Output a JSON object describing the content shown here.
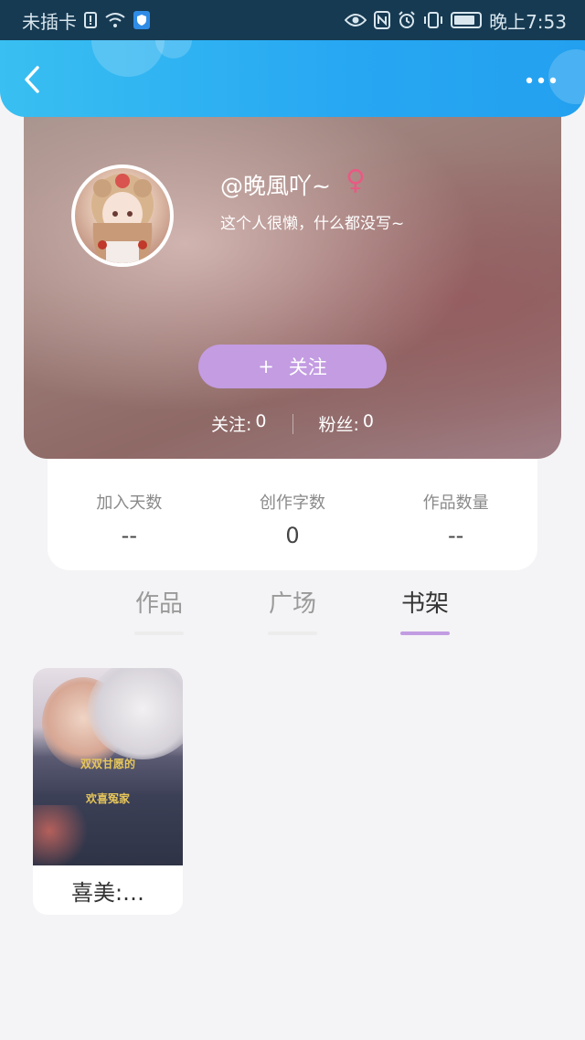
{
  "status_bar": {
    "carrier": "未插卡",
    "time": "晚上7:53"
  },
  "navbar": {
    "back_icon": "chevron-left-icon",
    "more_icon": "more-horizontal-icon"
  },
  "profile": {
    "username": "@晚風吖~",
    "gender_icon": "♀",
    "bio": "这个人很懒，什么都没写~",
    "follow_button": {
      "icon": "+",
      "label": "关注"
    },
    "following_label": "关注:",
    "following_count": "0",
    "fans_label": "粉丝:",
    "fans_count": "0"
  },
  "stats": [
    {
      "label": "加入天数",
      "value": "--"
    },
    {
      "label": "创作字数",
      "value": "0"
    },
    {
      "label": "作品数量",
      "value": "--"
    }
  ],
  "tabs": [
    {
      "label": "作品",
      "active": false
    },
    {
      "label": "广场",
      "active": false
    },
    {
      "label": "书架",
      "active": true
    }
  ],
  "bookshelf": [
    {
      "title": "喜美:…",
      "cover_text": [
        "双双甘愿的",
        "欢喜冤家"
      ]
    }
  ],
  "colors": {
    "nav_blue": "#27a7f2",
    "follow_purple": "#c39ce2",
    "gender_pink": "#e85a83",
    "tab_active_underline": "#c29ce2"
  }
}
